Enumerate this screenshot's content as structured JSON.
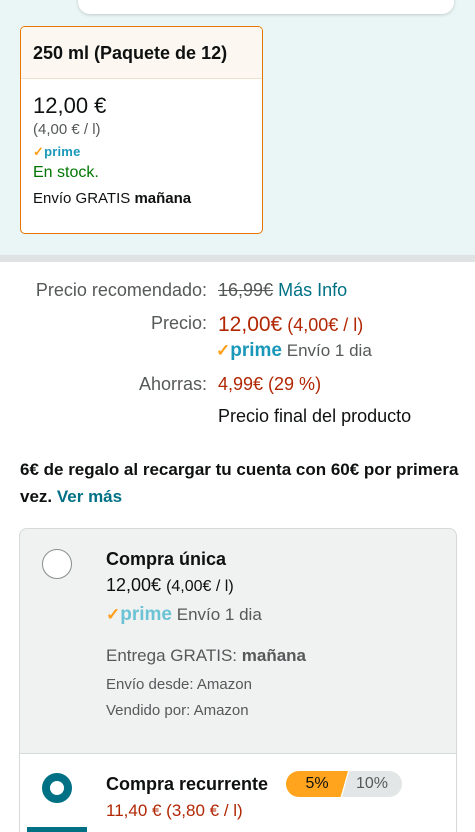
{
  "variant": {
    "header": "250 ml (Paquete de 12)",
    "price": "12,00 €",
    "unit_price": "(4,00 € / l)",
    "prime_label": "prime",
    "stock": "En stock.",
    "shipping_prefix": "Envío GRATIS",
    "shipping_day": "mañana"
  },
  "price_table": {
    "rrp_label": "Precio recomendado:",
    "rrp_value": "16,99€",
    "more_info": "Más Info",
    "price_label": "Precio:",
    "price_value": "12,00€",
    "price_unit": "(4,00€ / l)",
    "prime_label": "prime",
    "prime_shipping": "Envío 1 dia",
    "savings_label": "Ahorras:",
    "savings_value": "4,99€ (29 %)",
    "final_price_note": "Precio final del producto"
  },
  "promo": {
    "text": "6€ de regalo al recargar tu cuenta con 60€ por primera vez.",
    "link": "Ver más"
  },
  "options": {
    "one_time": {
      "title": "Compra única",
      "price": "12,00€",
      "unit": "(4,00€ / l)",
      "prime_label": "prime",
      "prime_shipping": "Envío 1 dia",
      "delivery_prefix": "Entrega GRATIS:",
      "delivery_day": "mañana",
      "ships_from": "Envío desde: Amazon",
      "sold_by": "Vendido por: Amazon",
      "selected": false
    },
    "recurring": {
      "title": "Compra recurrente",
      "badge_selected": "5%",
      "badge_other": "10%",
      "price": "11,40 € (3,80 € / l)",
      "selected": true
    }
  },
  "colors": {
    "accent_orange": "#e77600",
    "link_teal": "#007185",
    "price_red": "#b12704",
    "stock_green": "#007600",
    "prime_blue": "#1a98b9"
  }
}
